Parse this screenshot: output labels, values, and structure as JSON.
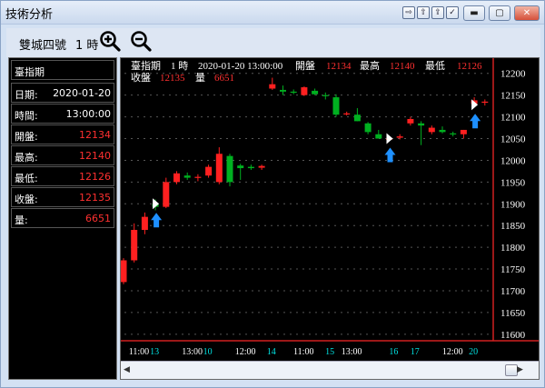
{
  "window": {
    "title": "技術分析",
    "minimize": "▬",
    "maximize": "▢",
    "close": "✕"
  },
  "title_tools": [
    "⇨",
    "⇧",
    "⇪",
    "✓"
  ],
  "toolbar": {
    "symbol": "雙城四號",
    "period": "1 時"
  },
  "info_panel": {
    "name": "臺指期",
    "rows": [
      {
        "label": "日期:",
        "value": "2020-01-20",
        "color": "#ffffff"
      },
      {
        "label": "時間:",
        "value": "13:00:00",
        "color": "#ffffff"
      },
      {
        "label": "開盤:",
        "value": "12134",
        "color": "#ff3030"
      },
      {
        "label": "最高:",
        "value": "12140",
        "color": "#ff3030"
      },
      {
        "label": "最低:",
        "value": "12126",
        "color": "#ff3030"
      },
      {
        "label": "收盤:",
        "value": "12135",
        "color": "#ff3030"
      },
      {
        "label": "量:",
        "value": "6651",
        "color": "#ff3030"
      }
    ]
  },
  "chart_header": {
    "name": "臺指期",
    "period": "1 時",
    "datetime": "2020-01-20 13:00:00",
    "open_label": "開盤",
    "open": "12134",
    "high_label": "最高",
    "high": "12140",
    "low_label": "最低",
    "low": "12126",
    "close_label": "收盤",
    "close": "12135",
    "vol_label": "量",
    "vol": "6651"
  },
  "chart_data": {
    "type": "candlestick",
    "ylim": [
      11585,
      12235
    ],
    "y_ticks": [
      12200,
      12150,
      12100,
      12050,
      12000,
      11950,
      11900,
      11850,
      11800,
      11750,
      11700,
      11650,
      11600
    ],
    "x_labels": [
      {
        "text": "11:00",
        "i": 1,
        "color": "#ffffff"
      },
      {
        "text": "13",
        "i": 3,
        "color": "#00e0e0"
      },
      {
        "text": "13:00",
        "i": 6,
        "color": "#ffffff"
      },
      {
        "text": "10",
        "i": 8,
        "color": "#00e0e0"
      },
      {
        "text": "12:00",
        "i": 11,
        "color": "#ffffff"
      },
      {
        "text": "14",
        "i": 14,
        "color": "#00e0e0"
      },
      {
        "text": "11:00",
        "i": 16.5,
        "color": "#ffffff"
      },
      {
        "text": "15",
        "i": 19.5,
        "color": "#00e0e0"
      },
      {
        "text": "13:00",
        "i": 21,
        "color": "#ffffff"
      },
      {
        "text": "16",
        "i": 25.5,
        "color": "#00e0e0"
      },
      {
        "text": "17",
        "i": 27.5,
        "color": "#00e0e0"
      },
      {
        "text": "12:00",
        "i": 30.5,
        "color": "#ffffff"
      },
      {
        "text": "20",
        "i": 33,
        "color": "#00e0e0"
      }
    ],
    "candles": [
      {
        "o": 11720,
        "h": 11775,
        "l": 11715,
        "c": 11770
      },
      {
        "o": 11770,
        "h": 11855,
        "l": 11765,
        "c": 11840
      },
      {
        "o": 11840,
        "h": 11880,
        "l": 11830,
        "c": 11870
      },
      {
        "o": 11900,
        "h": 11910,
        "l": 11885,
        "c": 11893
      },
      {
        "o": 11893,
        "h": 11960,
        "l": 11890,
        "c": 11950
      },
      {
        "o": 11950,
        "h": 11975,
        "l": 11945,
        "c": 11970
      },
      {
        "o": 11965,
        "h": 11972,
        "l": 11955,
        "c": 11960
      },
      {
        "o": 11960,
        "h": 11968,
        "l": 11952,
        "c": 11962
      },
      {
        "o": 11965,
        "h": 11990,
        "l": 11960,
        "c": 11985
      },
      {
        "o": 11950,
        "h": 12030,
        "l": 11945,
        "c": 12015
      },
      {
        "o": 12010,
        "h": 12015,
        "l": 11940,
        "c": 11950
      },
      {
        "o": 11988,
        "h": 11992,
        "l": 11955,
        "c": 11982
      },
      {
        "o": 11985,
        "h": 11990,
        "l": 11978,
        "c": 11982
      },
      {
        "o": 11983,
        "h": 11990,
        "l": 11978,
        "c": 11987
      },
      {
        "o": 12165,
        "h": 12190,
        "l": 12162,
        "c": 12175
      },
      {
        "o": 12162,
        "h": 12172,
        "l": 12150,
        "c": 12158
      },
      {
        "o": 12158,
        "h": 12163,
        "l": 12152,
        "c": 12156
      },
      {
        "o": 12150,
        "h": 12170,
        "l": 12148,
        "c": 12168
      },
      {
        "o": 12160,
        "h": 12165,
        "l": 12150,
        "c": 12152
      },
      {
        "o": 12150,
        "h": 12156,
        "l": 12140,
        "c": 12148
      },
      {
        "o": 12145,
        "h": 12152,
        "l": 12100,
        "c": 12105
      },
      {
        "o": 12108,
        "h": 12112,
        "l": 12103,
        "c": 12108
      },
      {
        "o": 12105,
        "h": 12120,
        "l": 12090,
        "c": 12090
      },
      {
        "o": 12085,
        "h": 12088,
        "l": 12060,
        "c": 12065
      },
      {
        "o": 12060,
        "h": 12070,
        "l": 12050,
        "c": 12050
      },
      {
        "o": 12050,
        "h": 12055,
        "l": 12045,
        "c": 12050
      },
      {
        "o": 12052,
        "h": 12060,
        "l": 12048,
        "c": 12055
      },
      {
        "o": 12085,
        "h": 12100,
        "l": 12080,
        "c": 12095
      },
      {
        "o": 12085,
        "h": 12090,
        "l": 12035,
        "c": 12080
      },
      {
        "o": 12065,
        "h": 12080,
        "l": 12060,
        "c": 12075
      },
      {
        "o": 12070,
        "h": 12078,
        "l": 12062,
        "c": 12065
      },
      {
        "o": 12062,
        "h": 12066,
        "l": 12055,
        "c": 12060
      },
      {
        "o": 12060,
        "h": 12070,
        "l": 12050,
        "c": 12070
      },
      {
        "o": 12130,
        "h": 12145,
        "l": 12125,
        "c": 12138
      },
      {
        "o": 12134,
        "h": 12140,
        "l": 12126,
        "c": 12135
      }
    ],
    "signals": [
      {
        "i": 3,
        "y": 11900
      },
      {
        "i": 25,
        "y": 12050
      },
      {
        "i": 33,
        "y": 12128
      }
    ]
  },
  "colors": {
    "up": "#ff2020",
    "down": "#00b020",
    "signal_arrow": "#1e90ff",
    "axis_text": "#ffffff",
    "hilite": "#ff3030"
  }
}
